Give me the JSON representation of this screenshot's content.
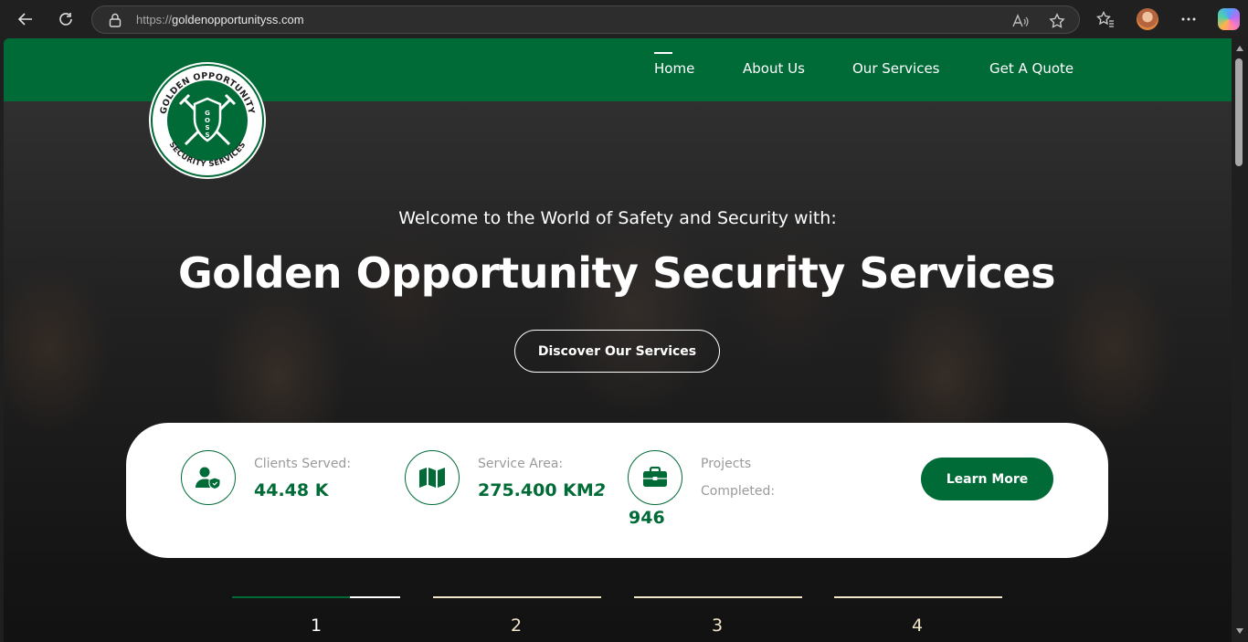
{
  "browser": {
    "url_protocol": "https://",
    "url_host": "goldenopportunityss.com",
    "icons": [
      "back-icon",
      "refresh-icon",
      "lock-icon",
      "read-aloud-icon",
      "favorite-star-icon",
      "favorites-collection-icon",
      "profile-avatar",
      "more-menu-icon",
      "copilot-icon"
    ]
  },
  "header": {
    "nav": [
      {
        "label": "Home",
        "active": true
      },
      {
        "label": "About Us",
        "active": false
      },
      {
        "label": "Our Services",
        "active": false
      },
      {
        "label": "Get A Quote",
        "active": false
      }
    ]
  },
  "logo": {
    "top_text": "GOLDEN OPPORTUNITY",
    "bottom_text": "SECURITY SERVICES",
    "shield_text": "GOSS"
  },
  "hero": {
    "welcome": "Welcome to the World of Safety and Security with:",
    "title": "Golden Opportunity Security Services",
    "cta": "Discover Our Services"
  },
  "stats": [
    {
      "icon": "user-shield-icon",
      "label": "Clients Served:",
      "value": "44.48 K"
    },
    {
      "icon": "map-icon",
      "label": "Service Area:",
      "value": "275.400 KM",
      "value_suffix": "2"
    },
    {
      "icon": "briefcase-icon",
      "label_line1": "Projects",
      "label_line2": "Completed:",
      "value": "946"
    }
  ],
  "learn_more": "Learn More",
  "slider": {
    "indicators": [
      "1",
      "2",
      "3",
      "4"
    ],
    "active_index": 0,
    "active_progress": 0.7
  },
  "colors": {
    "brand_green": "#006b37",
    "white": "#ffffff",
    "indicator_inactive": "#f2e6c9"
  }
}
